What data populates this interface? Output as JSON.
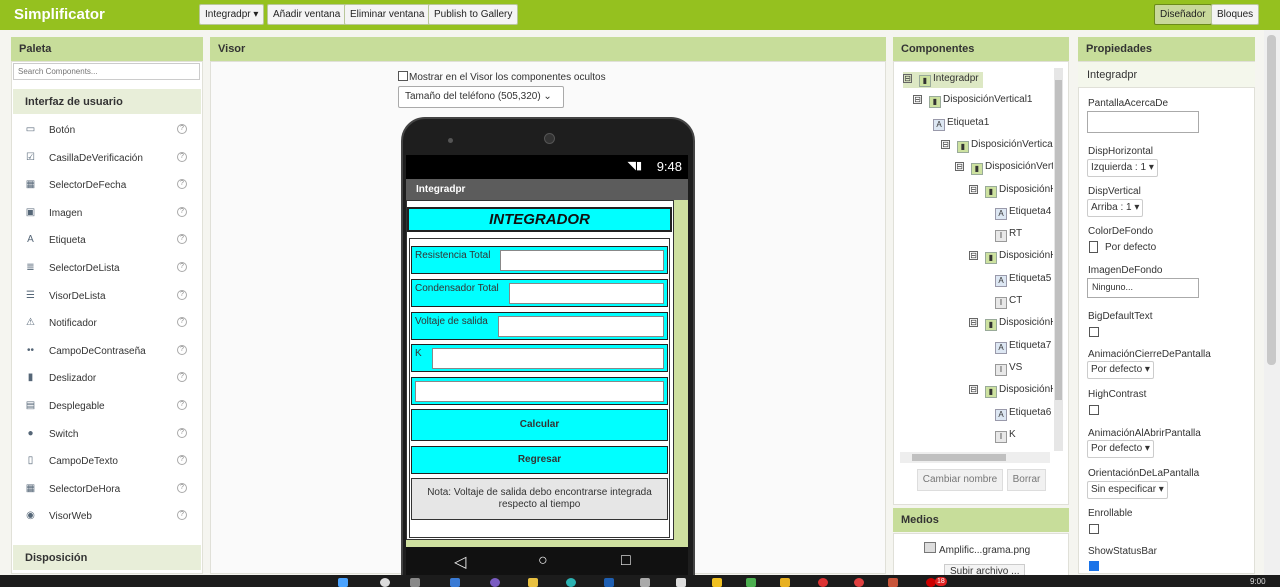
{
  "app": {
    "title": "Simplificator"
  },
  "toolbar": {
    "screen_select": "Integradpr ▾",
    "add_screen": "Añadir ventana",
    "remove_screen": "Eliminar ventana",
    "publish": "Publish to Gallery",
    "designer": "Diseñador",
    "blocks": "Bloques"
  },
  "palette": {
    "title": "Paleta",
    "search_placeholder": "Search Components...",
    "category": "Interfaz de usuario",
    "items": [
      "Botón",
      "CasillaDeVerificación",
      "SelectorDeFecha",
      "Imagen",
      "Etiqueta",
      "SelectorDeLista",
      "VisorDeLista",
      "Notificador",
      "CampoDeContraseña",
      "Deslizador",
      "Desplegable",
      "Switch",
      "CampoDeTexto",
      "SelectorDeHora",
      "VisorWeb"
    ],
    "help": "?",
    "category2": "Disposición"
  },
  "visor": {
    "title": "Visor",
    "show_hidden": "Mostrar en el Visor los componentes ocultos",
    "phone_size": "Tamaño del teléfono (505,320) ⌄",
    "clock": "9:48",
    "screen_title": "Integradpr",
    "heading": "INTEGRADOR",
    "fields": [
      "Resistencia Total",
      "Condensador Total",
      "Voltaje de salida",
      "K"
    ],
    "calc_button": "Calcular",
    "back_button": "Regresar",
    "note": "Nota: Voltaje de salida debo encontrarse integrada respecto al tiempo",
    "nav_back": "◁",
    "nav_home": "○",
    "nav_recent": "□"
  },
  "components": {
    "title": "Componentes",
    "tree": [
      {
        "label": "Integradpr",
        "kind": "screen",
        "toggle": "⊟"
      },
      {
        "label": "DisposiciónVertical1",
        "kind": "layout",
        "toggle": "⊟"
      },
      {
        "label": "Etiqueta1",
        "kind": "label",
        "toggle": ""
      },
      {
        "label": "DisposiciónVertical",
        "kind": "layout",
        "toggle": "⊟"
      },
      {
        "label": "DisposiciónVerti",
        "kind": "layout",
        "toggle": "⊟"
      },
      {
        "label": "DisposiciónH",
        "kind": "layout",
        "toggle": "⊟"
      },
      {
        "label": "Etiqueta4",
        "kind": "label",
        "toggle": ""
      },
      {
        "label": "RT",
        "kind": "text",
        "toggle": ""
      },
      {
        "label": "DisposiciónH",
        "kind": "layout",
        "toggle": "⊟"
      },
      {
        "label": "Etiqueta5",
        "kind": "label",
        "toggle": ""
      },
      {
        "label": "CT",
        "kind": "text",
        "toggle": ""
      },
      {
        "label": "DisposiciónH",
        "kind": "layout",
        "toggle": "⊟"
      },
      {
        "label": "Etiqueta7",
        "kind": "label",
        "toggle": ""
      },
      {
        "label": "VS",
        "kind": "text",
        "toggle": ""
      },
      {
        "label": "DisposiciónH",
        "kind": "layout",
        "toggle": "⊟"
      },
      {
        "label": "Etiqueta6",
        "kind": "label",
        "toggle": ""
      },
      {
        "label": "K",
        "kind": "text",
        "toggle": ""
      }
    ],
    "rename": "Cambiar nombre",
    "delete": "Borrar"
  },
  "media": {
    "title": "Medios",
    "file": "Amplific...grama.png",
    "upload": "Subir archivo ..."
  },
  "properties": {
    "title": "Propiedades",
    "component": "Integradpr",
    "about_label": "PantallaAcercaDe",
    "halign_label": "DispHorizontal",
    "halign_value": "Izquierda : 1 ▾",
    "valign_label": "DispVertical",
    "valign_value": "Arriba : 1 ▾",
    "bg_label": "ColorDeFondo",
    "bg_value": "Por defecto",
    "bgimg_label": "ImagenDeFondo",
    "bgimg_value": "Ninguno...",
    "bigtext_label": "BigDefaultText",
    "close_anim_label": "AnimaciónCierreDePantalla",
    "close_anim_value": "Por defecto ▾",
    "contrast_label": "HighContrast",
    "open_anim_label": "AnimaciónAlAbrirPantalla",
    "open_anim_value": "Por defecto ▾",
    "orient_label": "OrientaciónDeLaPantalla",
    "orient_value": "Sin especificar ▾",
    "scroll_label": "Enrollable",
    "status_label": "ShowStatusBar"
  },
  "taskbar": {
    "clock": "9:00",
    "badge": "18"
  }
}
